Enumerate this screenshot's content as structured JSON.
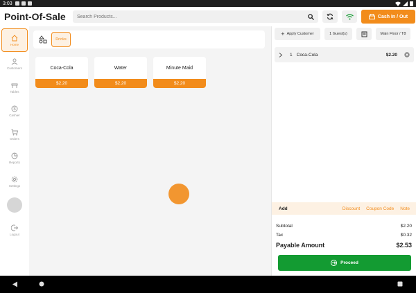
{
  "status": {
    "time": "3:03"
  },
  "header": {
    "title": "Point-Of-Sale",
    "search_placeholder": "Search Products...",
    "cash_button": "Cash In / Out"
  },
  "sidebar": {
    "items": [
      {
        "label": "Home",
        "icon": "home-icon",
        "active": true
      },
      {
        "label": "Customers",
        "icon": "user-icon"
      },
      {
        "label": "Tables",
        "icon": "table-icon"
      },
      {
        "label": "Cashier",
        "icon": "dollar-icon"
      },
      {
        "label": "Orders",
        "icon": "cart-icon"
      },
      {
        "label": "Reports",
        "icon": "pie-chart-icon"
      },
      {
        "label": "Settings",
        "icon": "gear-icon"
      }
    ],
    "logout": "Logout"
  },
  "categories": {
    "active": "Drinks"
  },
  "products": [
    {
      "name": "Coca-Cola",
      "price": "$2.20"
    },
    {
      "name": "Water",
      "price": "$2.20"
    },
    {
      "name": "Minute Maid",
      "price": "$2.20"
    }
  ],
  "cart": {
    "apply_customer": "Apply Customer",
    "guests": "1 Guest(s)",
    "floor": "Main Floor / T8",
    "items": [
      {
        "qty": "1",
        "name": "Coca-Cola",
        "price": "$2.20"
      }
    ],
    "actions": {
      "add": "Add",
      "discount": "Discount",
      "coupon": "Coupon Code",
      "note": "Note"
    },
    "subtotal_label": "Subtotal",
    "subtotal": "$2.20",
    "tax_label": "Tax",
    "tax": "$0.32",
    "payable_label": "Payable Amount",
    "payable": "$2.53",
    "proceed": "Proceed"
  },
  "colors": {
    "accent": "#f28c1b",
    "proceed": "#139b32"
  }
}
